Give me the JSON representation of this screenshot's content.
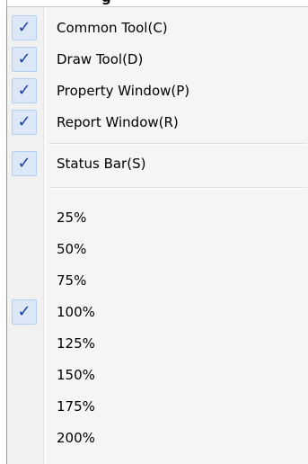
{
  "menu": {
    "top_partial_text": "g",
    "group_toolbars": [
      {
        "label": "Common Tool(C)",
        "checked": true
      },
      {
        "label": "Draw Tool(D)",
        "checked": true
      },
      {
        "label": "Property Window(P)",
        "checked": true
      },
      {
        "label": "Report Window(R)",
        "checked": true
      }
    ],
    "status_bar": {
      "label": "Status Bar(S)",
      "checked": true
    },
    "zoom_levels": [
      {
        "label": "25%",
        "checked": false
      },
      {
        "label": "50%",
        "checked": false
      },
      {
        "label": "75%",
        "checked": false
      },
      {
        "label": "100%",
        "checked": true
      },
      {
        "label": "125%",
        "checked": false
      },
      {
        "label": "150%",
        "checked": false
      },
      {
        "label": "175%",
        "checked": false
      },
      {
        "label": "200%",
        "checked": false
      }
    ],
    "check_glyph": "✓"
  }
}
